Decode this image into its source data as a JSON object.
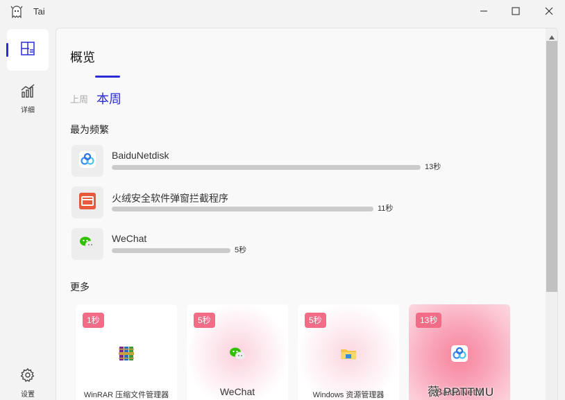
{
  "window": {
    "title": "Tai"
  },
  "sidebar": {
    "items": [
      {
        "icon": "dashboard-icon",
        "label": ""
      },
      {
        "icon": "chart-icon",
        "label": "详细"
      },
      {
        "icon": "gear-icon",
        "label": "设置"
      }
    ]
  },
  "main": {
    "title": "概览",
    "tabs": {
      "previous": "上周",
      "current": "本周"
    },
    "frequent_title": "最为频繁",
    "frequent": [
      {
        "name": "BaiduNetdisk",
        "time": "13秒",
        "seconds": 13,
        "icon": "baidunetdisk-icon",
        "color": "#3a8ef6"
      },
      {
        "name": "火绒安全软件弹窗拦截程序",
        "time": "11秒",
        "seconds": 11,
        "icon": "huorong-icon",
        "color": "#e8583c"
      },
      {
        "name": "WeChat",
        "time": "5秒",
        "seconds": 5,
        "icon": "wechat-icon",
        "color": "#2dc100"
      }
    ],
    "more_title": "更多",
    "cards": [
      {
        "badge": "1秒",
        "name": "WinRAR 压缩文件管理器",
        "icon": "winrar-icon"
      },
      {
        "badge": "5秒",
        "name": "WeChat",
        "icon": "wechat-icon"
      },
      {
        "badge": "5秒",
        "name": "Windows 资源管理器",
        "icon": "folder-icon"
      },
      {
        "badge": "13秒",
        "name": "BaiduNetdi",
        "icon": "baidunetdisk-icon"
      }
    ]
  },
  "watermark": "薇 PPTTMU",
  "colors": {
    "accent": "#2b2bd6",
    "badge": "#f26b87"
  }
}
